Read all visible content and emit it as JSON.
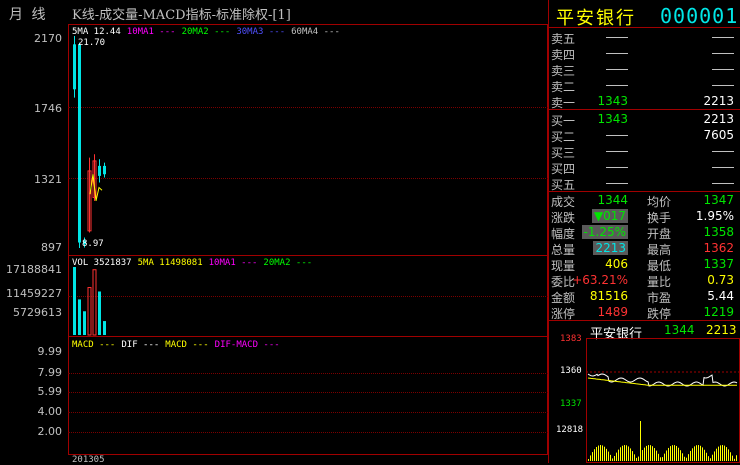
{
  "header": {
    "period": "月  线",
    "chart_title": "K线-成交量-MACD指标-标准除权-[1]",
    "stock_name": "平安银行",
    "stock_code": "000001"
  },
  "kline": {
    "ma_legend": [
      {
        "label": "5MA 12.44",
        "color": "#ffffff"
      },
      {
        "label": "10MA1 ---",
        "color": "#ff00ff"
      },
      {
        "label": "20MA2 ---",
        "color": "#00ff00"
      },
      {
        "label": "30MA3 ---",
        "color": "#5050ff"
      },
      {
        "label": "60MA4 ---",
        "color": "#c0c0c0"
      }
    ],
    "y_ticks": [
      "2170",
      "1746",
      "1321",
      "897"
    ],
    "high_label": "21.70",
    "low_label": "8.97"
  },
  "volume": {
    "legend": [
      {
        "label": "VOL 3521837",
        "color": "#ffffff"
      },
      {
        "label": "5MA 11498081",
        "color": "#ffff00"
      },
      {
        "label": "10MA1 ---",
        "color": "#ff00ff"
      },
      {
        "label": "20MA2 ---",
        "color": "#00ff00"
      }
    ],
    "y_ticks": [
      "17188841",
      "11459227",
      "5729613"
    ]
  },
  "macd": {
    "legend": [
      {
        "label": "MACD ---",
        "color": "#ffff00"
      },
      {
        "label": "DIF ---",
        "color": "#ffffff"
      },
      {
        "label": "MACD ---",
        "color": "#ffff00"
      },
      {
        "label": "DIF-MACD ---",
        "color": "#ff00ff"
      }
    ],
    "y_ticks": [
      "9.99",
      "7.99",
      "5.99",
      "4.00",
      "2.00"
    ]
  },
  "date_label": "201305",
  "orderbook": {
    "sell": [
      {
        "label": "卖五",
        "price": "",
        "vol": ""
      },
      {
        "label": "卖四",
        "price": "",
        "vol": ""
      },
      {
        "label": "卖三",
        "price": "",
        "vol": ""
      },
      {
        "label": "卖二",
        "price": "",
        "vol": ""
      },
      {
        "label": "卖一",
        "price": "1343",
        "vol": "2213"
      }
    ],
    "buy": [
      {
        "label": "买一",
        "price": "1343",
        "vol": "2213"
      },
      {
        "label": "买二",
        "price": "",
        "vol": "7605"
      },
      {
        "label": "买三",
        "price": "",
        "vol": ""
      },
      {
        "label": "买四",
        "price": "",
        "vol": ""
      },
      {
        "label": "买五",
        "price": "",
        "vol": ""
      }
    ]
  },
  "stats": [
    {
      "l1": "成交",
      "v1": "1344",
      "c1": "#00e600",
      "l2": "均价",
      "v2": "1347",
      "c2": "#00e600"
    },
    {
      "l1": "涨跌",
      "v1": "▼017",
      "c1": "#00e600",
      "l2": "换手",
      "v2": "1.95%",
      "c2": "#ffffff"
    },
    {
      "l1": "幅度",
      "v1": "-1.25%",
      "c1": "#00e600",
      "l2": "开盘",
      "v2": "1358",
      "c2": "#00e600"
    },
    {
      "l1": "总量",
      "v1": "2213",
      "c1": "#00e6e6",
      "l2": "最高",
      "v2": "1362",
      "c2": "#ff3232"
    },
    {
      "l1": "现量",
      "v1": "406",
      "c1": "#ffff00",
      "l2": "最低",
      "v2": "1337",
      "c2": "#00e600"
    },
    {
      "l1": "委比",
      "v1": "+63.21%",
      "c1": "#ff3232",
      "l2": "量比",
      "v2": "0.73",
      "c2": "#ffff00"
    },
    {
      "l1": "金额",
      "v1": "81516",
      "c1": "#ffff00",
      "l2": "市盈",
      "v2": "5.44",
      "c2": "#ffffff"
    },
    {
      "l1": "涨停",
      "v1": "1489",
      "c1": "#ff3232",
      "l2": "跌停",
      "v2": "1219",
      "c2": "#00e600"
    }
  ],
  "mini": {
    "name": "平安银行",
    "price": "1344",
    "vol": "2213",
    "y_ticks": [
      "1383",
      "1360",
      "1337"
    ],
    "vol_tick": "12818"
  },
  "chart_data": {
    "type": "candlestick",
    "y_range": [
      8.97,
      21.7
    ],
    "candles": [
      {
        "open": 18.5,
        "close": 21.2,
        "high": 21.7,
        "low": 18.0,
        "color": "cyan"
      },
      {
        "open": 21.2,
        "close": 9.3,
        "high": 21.3,
        "low": 8.97,
        "color": "cyan"
      },
      {
        "open": 9.4,
        "close": 9.2,
        "high": 9.6,
        "low": 9.0,
        "color": "cyan"
      },
      {
        "open": 10.0,
        "close": 13.6,
        "high": 14.4,
        "low": 9.9,
        "color": "red"
      },
      {
        "open": 12.0,
        "close": 14.2,
        "high": 14.6,
        "low": 11.8,
        "color": "red"
      },
      {
        "open": 13.9,
        "close": 13.3,
        "high": 14.3,
        "low": 12.9,
        "color": "cyan"
      },
      {
        "open": 13.9,
        "close": 13.4,
        "high": 14.1,
        "low": 13.2,
        "color": "cyan"
      }
    ],
    "volume": [
      17188841,
      9000000,
      6000000,
      12000000,
      16500000,
      11000000,
      3521837
    ]
  }
}
